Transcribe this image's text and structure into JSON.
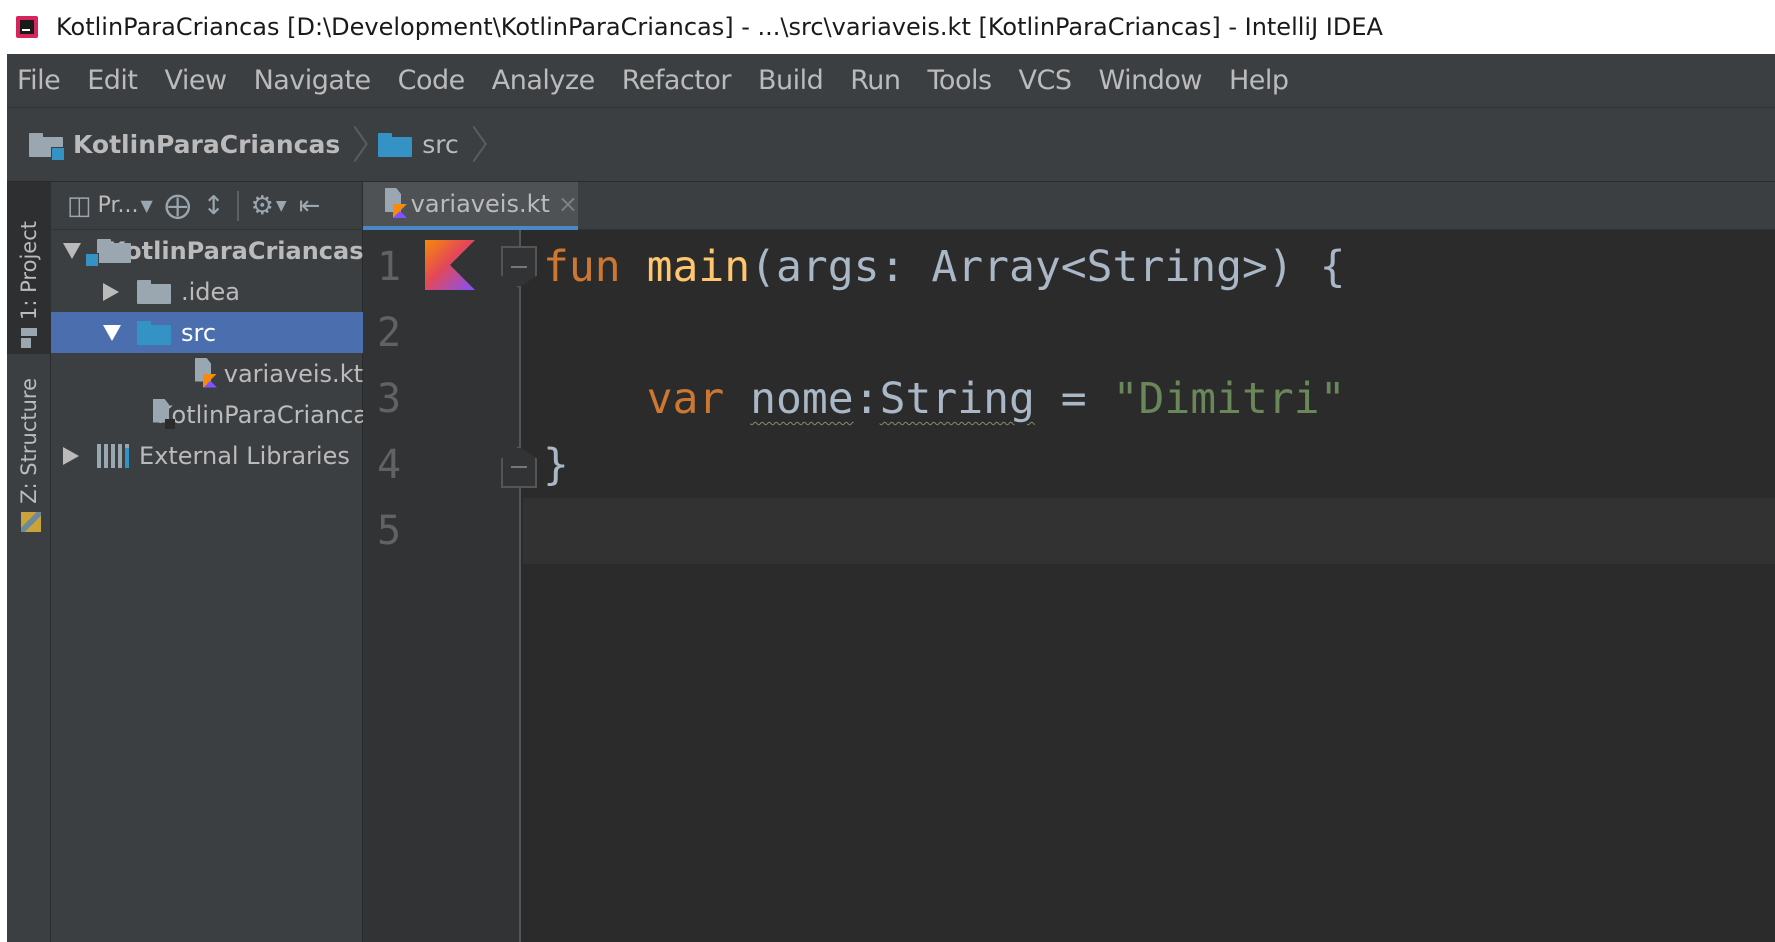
{
  "window": {
    "title": "KotlinParaCriancas [D:\\Development\\KotlinParaCriancas] - ...\\src\\variaveis.kt [KotlinParaCriancas] - IntelliJ IDEA"
  },
  "menu": {
    "items": [
      "File",
      "Edit",
      "View",
      "Navigate",
      "Code",
      "Analyze",
      "Refactor",
      "Build",
      "Run",
      "Tools",
      "VCS",
      "Window",
      "Help"
    ]
  },
  "breadcrumb": {
    "project": "KotlinParaCriancas",
    "folder": "src"
  },
  "tool_stripe": {
    "project_label": "1: Project",
    "structure_label": "Z: Structure"
  },
  "project_panel": {
    "view_label": "Pr...",
    "tree": {
      "root": "KotlinParaCriancas",
      "idea": ".idea",
      "src": "src",
      "file": "variaveis.kt",
      "iml": "KotlinParaCriancas.iml",
      "libraries": "External Libraries"
    }
  },
  "editor": {
    "tab_label": "variaveis.kt",
    "tab_close": "×",
    "line_numbers": [
      "1",
      "2",
      "3",
      "4",
      "5"
    ],
    "code": {
      "l1_kw": "fun",
      "l1_name": "main",
      "l1_params": "(args: Array<String>) {",
      "l3_kw": "var",
      "l3_name": "nome",
      "l3_colon": ":",
      "l3_type": "String",
      "l3_eq": " = ",
      "l3_value": "\"Dimitri\"",
      "l4_brace": "}"
    }
  },
  "colors": {
    "keyword": "#cc7832",
    "function": "#ffc66d",
    "string": "#6a8759",
    "selection": "#4b6eaf",
    "folder_blue": "#3592c4"
  }
}
